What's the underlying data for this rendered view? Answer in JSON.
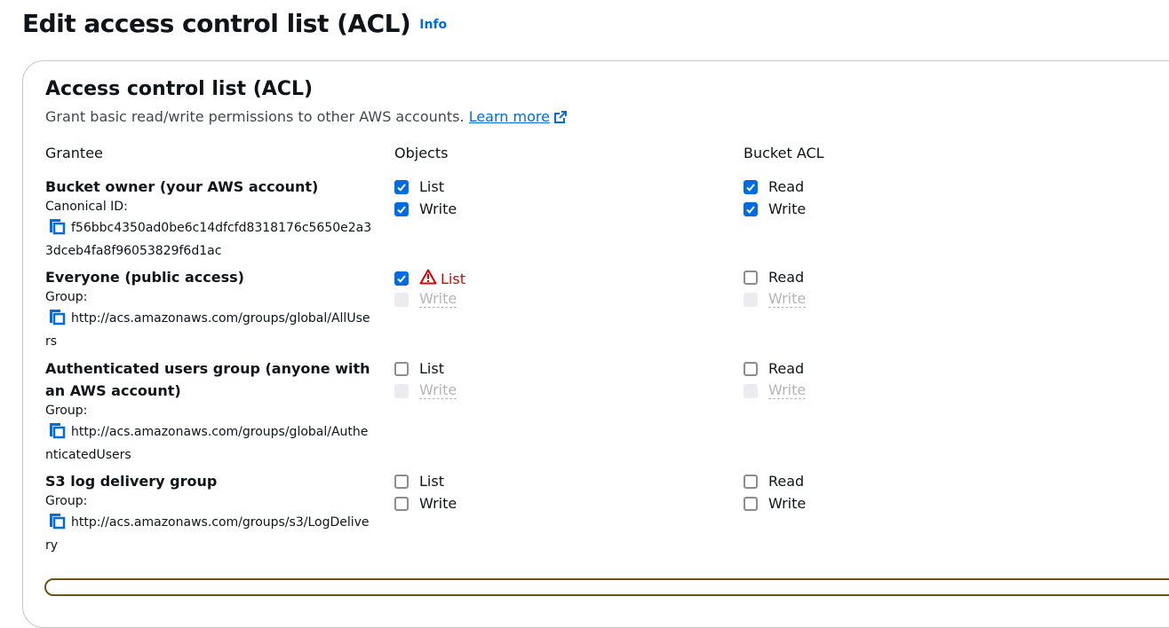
{
  "page": {
    "title": "Edit access control list (ACL)",
    "info_link": "Info"
  },
  "panel": {
    "title": "Access control list (ACL)",
    "description": "Grant basic read/write permissions to other AWS accounts.",
    "learn_more": "Learn more"
  },
  "columns": {
    "grantee": "Grantee",
    "objects": "Objects",
    "bucket_acl": "Bucket ACL"
  },
  "grantees": [
    {
      "name": "Bucket owner (your AWS account)",
      "id_label": "Canonical ID:",
      "id_value": "f56bbc4350ad0be6c14dfcfd8318176c5650e2a33dceb4fa8f96053829f6d1ac",
      "objects": [
        {
          "label": "List",
          "checked": true,
          "disabled": false,
          "warning": false
        },
        {
          "label": "Write",
          "checked": true,
          "disabled": false,
          "warning": false
        }
      ],
      "bucket_acl": [
        {
          "label": "Read",
          "checked": true,
          "disabled": false
        },
        {
          "label": "Write",
          "checked": true,
          "disabled": false
        }
      ]
    },
    {
      "name": "Everyone (public access)",
      "id_label": "Group:",
      "id_value": "http://acs.amazonaws.com/groups/global/AllUsers",
      "objects": [
        {
          "label": "List",
          "checked": true,
          "disabled": false,
          "warning": true
        },
        {
          "label": "Write",
          "checked": false,
          "disabled": true,
          "warning": false
        }
      ],
      "bucket_acl": [
        {
          "label": "Read",
          "checked": false,
          "disabled": false
        },
        {
          "label": "Write",
          "checked": false,
          "disabled": true
        }
      ]
    },
    {
      "name": "Authenticated users group (anyone with an AWS account)",
      "id_label": "Group:",
      "id_value": "http://acs.amazonaws.com/groups/global/AuthenticatedUsers",
      "objects": [
        {
          "label": "List",
          "checked": false,
          "disabled": false,
          "warning": false
        },
        {
          "label": "Write",
          "checked": false,
          "disabled": true,
          "warning": false
        }
      ],
      "bucket_acl": [
        {
          "label": "Read",
          "checked": false,
          "disabled": false
        },
        {
          "label": "Write",
          "checked": false,
          "disabled": true
        }
      ]
    },
    {
      "name": "S3 log delivery group",
      "id_label": "Group:",
      "id_value": "http://acs.amazonaws.com/groups/s3/LogDelivery",
      "objects": [
        {
          "label": "List",
          "checked": false,
          "disabled": false,
          "warning": false
        },
        {
          "label": "Write",
          "checked": false,
          "disabled": false,
          "warning": false
        }
      ],
      "bucket_acl": [
        {
          "label": "Read",
          "checked": false,
          "disabled": false
        },
        {
          "label": "Write",
          "checked": false,
          "disabled": false
        }
      ]
    }
  ],
  "colors": {
    "accent": "#006ce0",
    "warning": "#db0000",
    "disabled": "#b4b4bb"
  }
}
